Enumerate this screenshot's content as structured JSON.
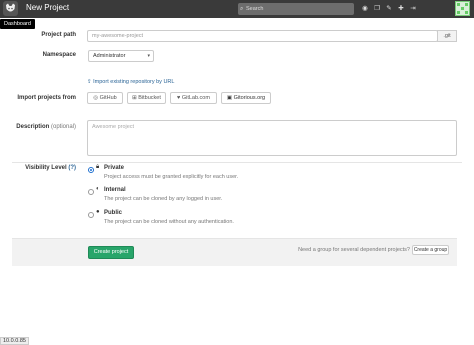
{
  "header": {
    "title": "New Project",
    "search_placeholder": "Search",
    "icons": [
      "search-icon",
      "globe-icon",
      "copy-icon",
      "wrench-icon",
      "plus-icon",
      "logout-icon"
    ]
  },
  "tooltip": {
    "text": "Dashboard"
  },
  "form": {
    "project_path": {
      "label": "Project path",
      "placeholder": "my-awesome-project",
      "addon": ".git"
    },
    "namespace": {
      "label": "Namespace",
      "value": "Administrator"
    },
    "import_url_link": "Import existing repository by URL",
    "import_projects": {
      "label": "Import projects from",
      "sources": [
        "GitHub",
        "Bitbucket",
        "GitLab.com",
        "Gitorious.org"
      ]
    },
    "description": {
      "label": "Description",
      "optional": "(optional)",
      "placeholder": "Awesome project"
    },
    "visibility": {
      "label": "Visibility Level",
      "help": "(?)",
      "options": [
        {
          "title": "Private",
          "desc": "Project access must be granted explicitly for each user.",
          "checked": true
        },
        {
          "title": "Internal",
          "desc": "The project can be cloned by any logged in user.",
          "checked": false
        },
        {
          "title": "Public",
          "desc": "The project can be cloned without any authentication.",
          "checked": false
        }
      ]
    }
  },
  "footer": {
    "create_button": "Create project",
    "hint": "Need a group for several dependent projects?",
    "group_button": "Create a group"
  },
  "status_bar": {
    "text": "10.0.0.85"
  }
}
